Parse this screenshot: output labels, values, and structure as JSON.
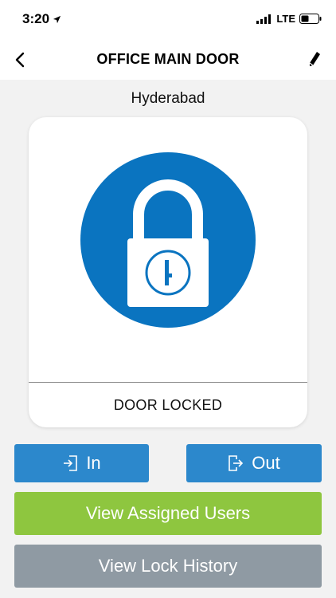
{
  "status_bar": {
    "time": "3:20",
    "location_arrow_icon": "location-arrow-icon",
    "carrier": "LTE"
  },
  "nav": {
    "title": "OFFICE MAIN DOOR",
    "back_icon": "chevron-left-icon",
    "edit_icon": "pencil-icon"
  },
  "lock": {
    "location": "Hyderabad",
    "icon": "padlock-icon",
    "status": "DOOR LOCKED",
    "accent_color": "#0a74c0"
  },
  "actions": {
    "in_label": "In",
    "out_label": "Out",
    "assigned_users_label": "View Assigned Users",
    "lock_history_label": "View Lock History"
  },
  "colors": {
    "primary_button": "#2c88cc",
    "assigned_button": "#8ec63f",
    "history_button": "#8f9aa3"
  }
}
